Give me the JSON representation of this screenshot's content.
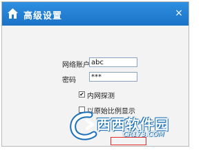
{
  "dialog": {
    "title": "高级设置",
    "close_glyph": "×",
    "account_label": "网络账户",
    "account_value": "abc",
    "password_label": "密码",
    "password_value": "***",
    "probe_checkbox": {
      "label": "内网探测",
      "checked": true,
      "mark": "✔"
    },
    "ratio_checkbox": {
      "label": "以原始比例显示",
      "checked": false
    }
  },
  "watermark": {
    "text": "西西软件园",
    "url": "CR173.COM"
  },
  "colors": {
    "titlebar": "#1f7ed3",
    "dialog_bg": "#f3f3f3",
    "highlight_box": "#e12b2b"
  }
}
